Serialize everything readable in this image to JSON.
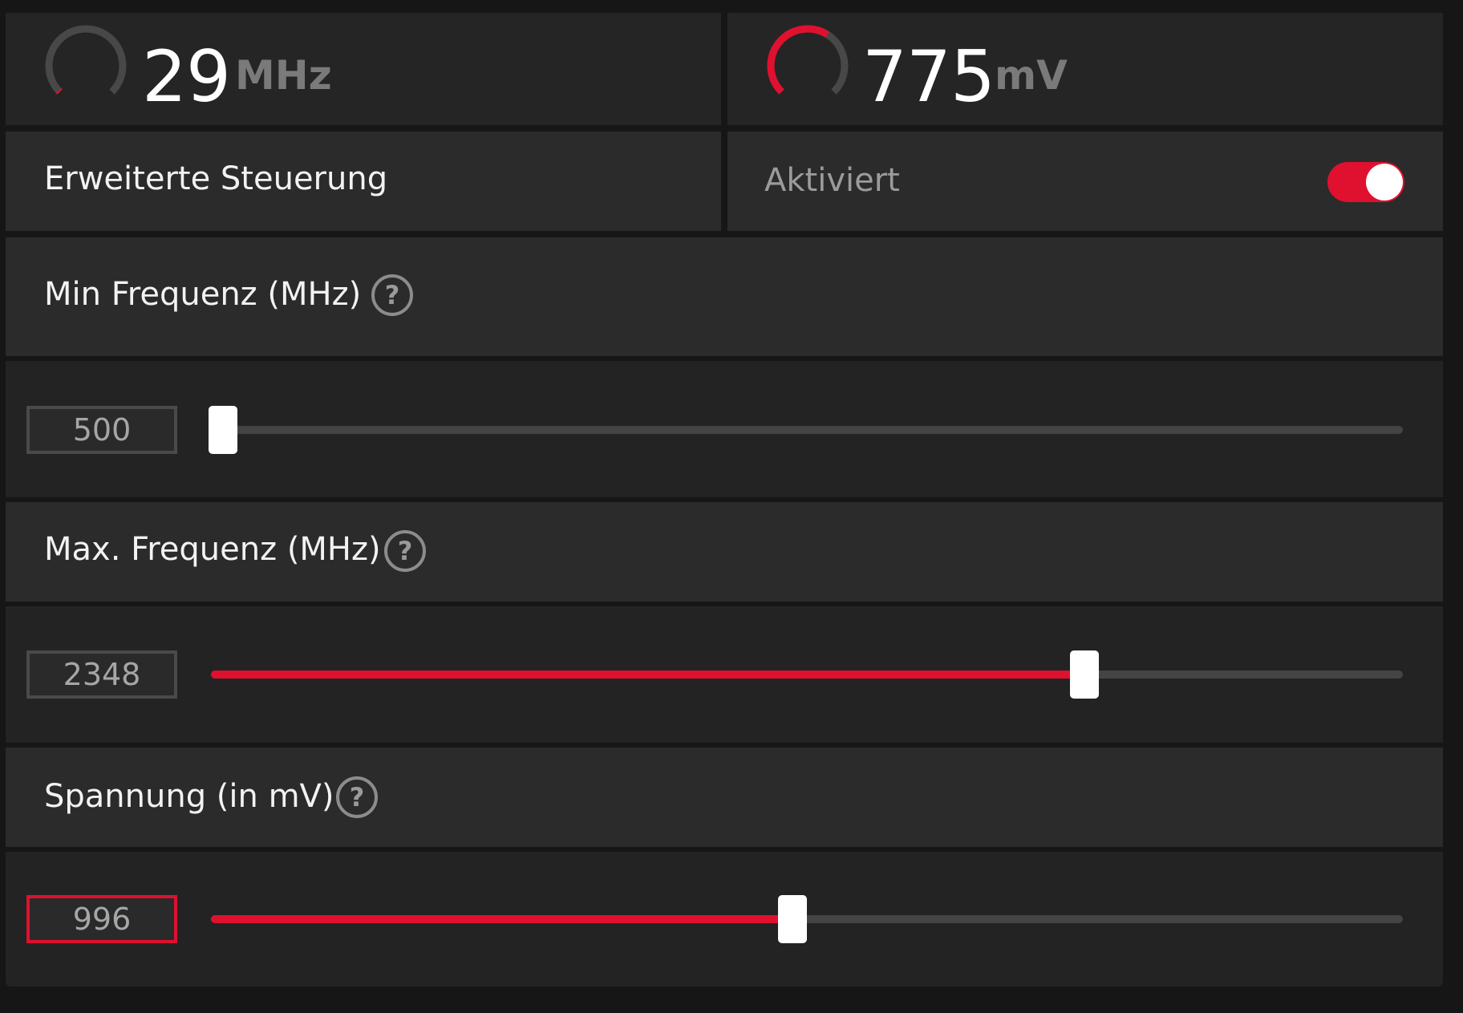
{
  "gauges": {
    "clock": {
      "value": "29",
      "unit": "MHz",
      "level": 0.01
    },
    "voltage": {
      "value": "775",
      "unit": "mV",
      "level": 0.62
    }
  },
  "advanced_control": {
    "label": "Erweiterte Steuerung",
    "status": "Aktiviert",
    "enabled": true
  },
  "min_frequency": {
    "label": "Min Frequenz (MHz)",
    "help": "?",
    "value": "500",
    "fill": 0.01
  },
  "max_frequency": {
    "label": "Max. Frequenz (MHz)",
    "help": "?",
    "value": "2348",
    "fill": 0.733
  },
  "voltage_setting": {
    "label": "Spannung (in mV)",
    "help": "?",
    "value": "996",
    "fill": 0.488
  },
  "colors": {
    "accent": "#e0102f",
    "panel": "#2b2b2b",
    "panel_alt": "#232323",
    "track": "#444444"
  }
}
